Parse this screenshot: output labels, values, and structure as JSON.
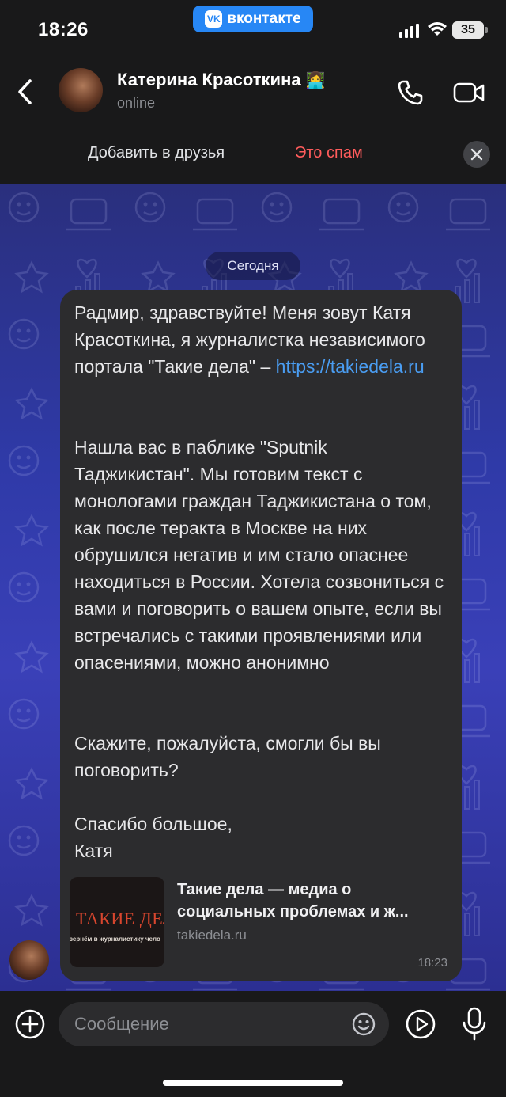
{
  "status_bar": {
    "time": "18:26",
    "app_pill": "вконтакте",
    "app_logo": "vk",
    "battery": "35",
    "icons": [
      "cellular-signal-icon",
      "wifi-icon",
      "battery-icon"
    ]
  },
  "header": {
    "contact_name": "Катерина Красоткина",
    "name_emoji": "👩‍💻",
    "status": "online",
    "icons": [
      "back-icon",
      "phone-icon",
      "video-camera-icon"
    ]
  },
  "friend_bar": {
    "add_friend": "Добавить в друзья",
    "spam": "Это спам",
    "close_icon": "close-icon"
  },
  "chat": {
    "date_label": "Сегодня",
    "message": {
      "p1_text": "Радмир, здравствуйте! Меня зовут Катя Красоткина, я журналистка независимого портала \"Такие дела\" – ",
      "p1_link": "https://takiedela.ru",
      "p2": "Нашла вас в паблике \"Sputnik Таджикистан\". Мы готовим текст с монологами граждан Таджикистана о том, как после теракта в Москве на них обрушился негатив и им стало опаснее находиться в России. Хотела созвониться с вами и поговорить о вашем опыте, если вы встречались с такими проявлениями или опасениями, можно анонимно",
      "p3": "Скажите, пожалуйста, смогли бы вы поговорить?",
      "p4": "Спасибо большое,\nКатя",
      "time": "18:23"
    },
    "link_preview": {
      "thumb_title": "ТАКИЕ ДЕЛА",
      "thumb_subtitle": "зернём в журналистику чело",
      "title": "Такие дела — медиа о социальных проблемах и ж...",
      "domain": "takiedela.ru"
    }
  },
  "composer": {
    "placeholder": "Сообщение",
    "value": "",
    "icons": [
      "plus-icon",
      "emoji-icon",
      "play-icon",
      "microphone-icon"
    ]
  },
  "colors": {
    "background": "#19191a",
    "bubble": "#2c2c2e",
    "accent": "#2787f5",
    "link": "#4a9df2",
    "spam": "#ff5c5c",
    "wallpaper_top": "#2a2f7d",
    "wallpaper_mid": "#3a40b8"
  }
}
